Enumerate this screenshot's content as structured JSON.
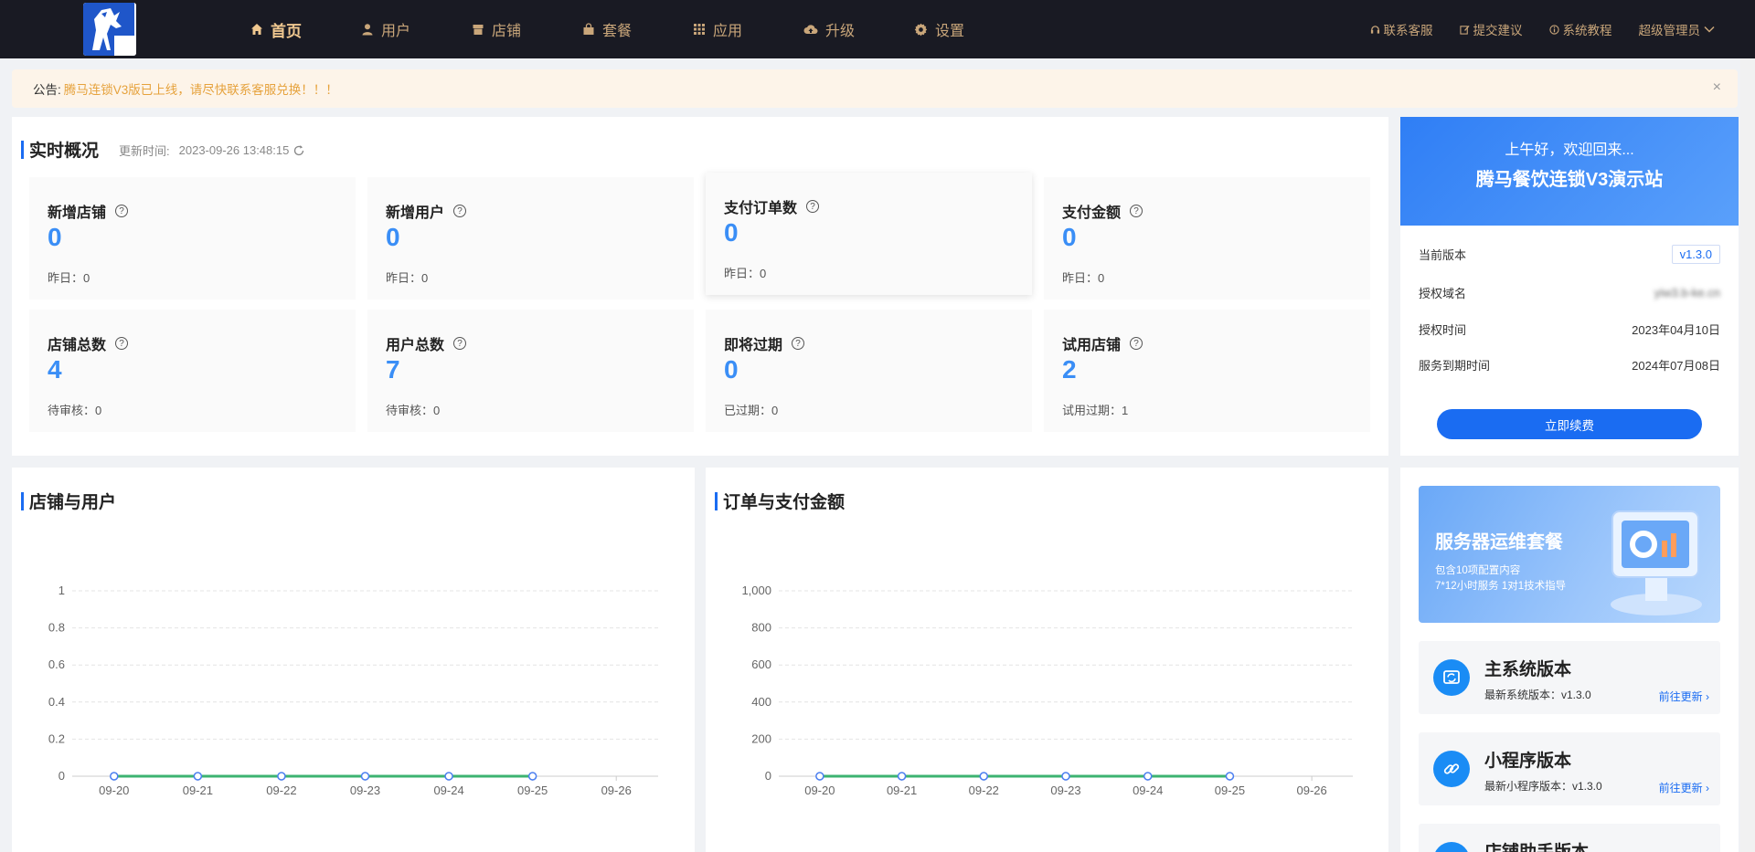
{
  "nav": {
    "items": [
      {
        "label": "首页",
        "icon": "home-icon"
      },
      {
        "label": "用户",
        "icon": "user-icon"
      },
      {
        "label": "店铺",
        "icon": "shop-icon"
      },
      {
        "label": "套餐",
        "icon": "bag-icon"
      },
      {
        "label": "应用",
        "icon": "grid-icon"
      },
      {
        "label": "升级",
        "icon": "cloud-upload-icon"
      },
      {
        "label": "设置",
        "icon": "gear-icon"
      }
    ],
    "right": {
      "contact": "联系客服",
      "suggest": "提交建议",
      "tutorial": "系统教程",
      "user": "超级管理员"
    }
  },
  "notice": {
    "label": "公告:",
    "text": "腾马连锁V3版已上线，请尽快联系客服兑换！！！"
  },
  "overview": {
    "title": "实时概况",
    "updated_label": "更新时间:",
    "updated_time": "2023-09-26 13:48:15",
    "stats": [
      {
        "title": "新增店铺",
        "value": "0",
        "sub": "昨日：0"
      },
      {
        "title": "新增用户",
        "value": "0",
        "sub": "昨日：0"
      },
      {
        "title": "支付订单数",
        "value": "0",
        "sub": "昨日：0"
      },
      {
        "title": "支付金额",
        "value": "0",
        "sub": "昨日：0"
      },
      {
        "title": "店铺总数",
        "value": "4",
        "sub": "待审核：0"
      },
      {
        "title": "用户总数",
        "value": "7",
        "sub": "待审核：0"
      },
      {
        "title": "即将过期",
        "value": "0",
        "sub": "已过期：0"
      },
      {
        "title": "试用店铺",
        "value": "2",
        "sub": "试用过期：1"
      }
    ]
  },
  "welcome": {
    "greeting": "上午好，欢迎回来...",
    "site": "腾马餐饮连锁V3演示站",
    "rows": [
      {
        "label": "当前版本",
        "value": "v1.3.0"
      },
      {
        "label": "授权域名",
        "value": "yiw3.b-ke.cn"
      },
      {
        "label": "授权时间",
        "value": "2023年04月10日"
      },
      {
        "label": "服务到期时间",
        "value": "2024年07月08日"
      }
    ],
    "renew_button": "立即续费"
  },
  "promo": {
    "title": "服务器运维套餐",
    "line1": "包含10项配置内容",
    "line2": "7*12小时服务 1对1技术指导"
  },
  "versions": [
    {
      "title": "主系统版本",
      "sub": "最新系统版本：v1.3.0",
      "link": "前往更新"
    },
    {
      "title": "小程序版本",
      "sub": "最新小程序版本：v1.3.0",
      "link": "前往更新"
    },
    {
      "title": "店铺助手版本",
      "sub": "",
      "link": ""
    }
  ],
  "colors": {
    "accent": "#1a6cf2",
    "stat_value": "#3a8ef6",
    "nav_text": "#c9a67a",
    "series_line": "#3cb371",
    "point_stroke": "#4a7ef0"
  },
  "chart_data": [
    {
      "type": "line",
      "title": "店铺与用户",
      "categories": [
        "09-20",
        "09-21",
        "09-22",
        "09-23",
        "09-24",
        "09-25",
        "09-26"
      ],
      "series": [
        {
          "values": [
            0,
            0,
            0,
            0,
            0,
            0
          ]
        }
      ],
      "ylim": [
        0,
        1
      ],
      "yticks": [
        "0",
        "0.2",
        "0.4",
        "0.6",
        "0.8",
        "1"
      ],
      "grid": true
    },
    {
      "type": "line",
      "title": "订单与支付金额",
      "categories": [
        "09-20",
        "09-21",
        "09-22",
        "09-23",
        "09-24",
        "09-25",
        "09-26"
      ],
      "series": [
        {
          "values": [
            0,
            0,
            0,
            0,
            0,
            0
          ]
        }
      ],
      "ylim": [
        0,
        1000
      ],
      "yticks": [
        "0",
        "200",
        "400",
        "600",
        "800",
        "1,000"
      ],
      "grid": true
    }
  ]
}
